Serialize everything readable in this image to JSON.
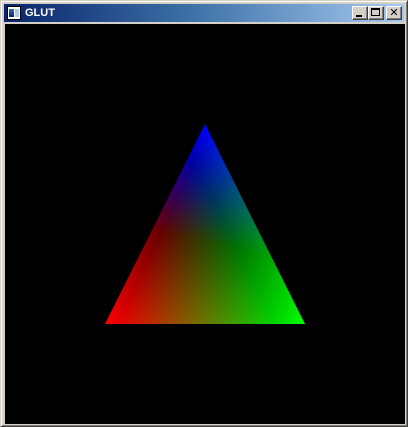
{
  "window": {
    "title": "GLUT",
    "icon": "app-window-icon",
    "controls": {
      "minimize_icon": "minimize-icon",
      "maximize_icon": "maximize-icon",
      "close_glyph": "✕"
    }
  },
  "canvas": {
    "background": "#000000",
    "triangle_vertex_colors": {
      "top": "#0000ff",
      "bottom_right": "#00ff00",
      "bottom_left": "#ff0000"
    }
  }
}
